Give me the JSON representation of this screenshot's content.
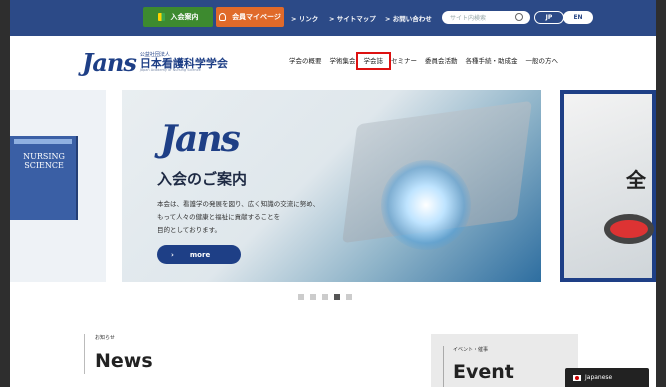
{
  "topbar": {
    "join_label": "入会案内",
    "mypage_label": "会員マイページ",
    "links": [
      "> リンク",
      "> サイトマップ",
      "> お問い合わせ"
    ],
    "search_placeholder": "サイト内検索",
    "lang_jp": "JP",
    "lang_en": "EN"
  },
  "logo": {
    "small": "公益社団法人",
    "name": "日本看護科学学会",
    "en": "Japan Academy of Nursing Science",
    "mark": "Jans"
  },
  "nav": {
    "items": [
      "学会の概要",
      "学術集会",
      "学会誌",
      "セミナー",
      "委員会活動",
      "各種手続・助成金",
      "一般の方へ"
    ]
  },
  "hero": {
    "book_title": "NURSING SCIENCE",
    "mark": "Jans",
    "title": "入会のご案内",
    "desc_lines": [
      "本会は、看護学の発展を図り、広く知識の交流に努め、",
      "もって人々の健康と福祉に貢献することを",
      "目的としております。"
    ],
    "more_arrow": "›",
    "more_label": "more",
    "right_text": "全",
    "active_dot": 3
  },
  "news": {
    "label": "お知らせ",
    "title": "News"
  },
  "event": {
    "label": "イベント・催事",
    "title": "Event"
  },
  "lang_widget": {
    "label": "Japanese"
  }
}
